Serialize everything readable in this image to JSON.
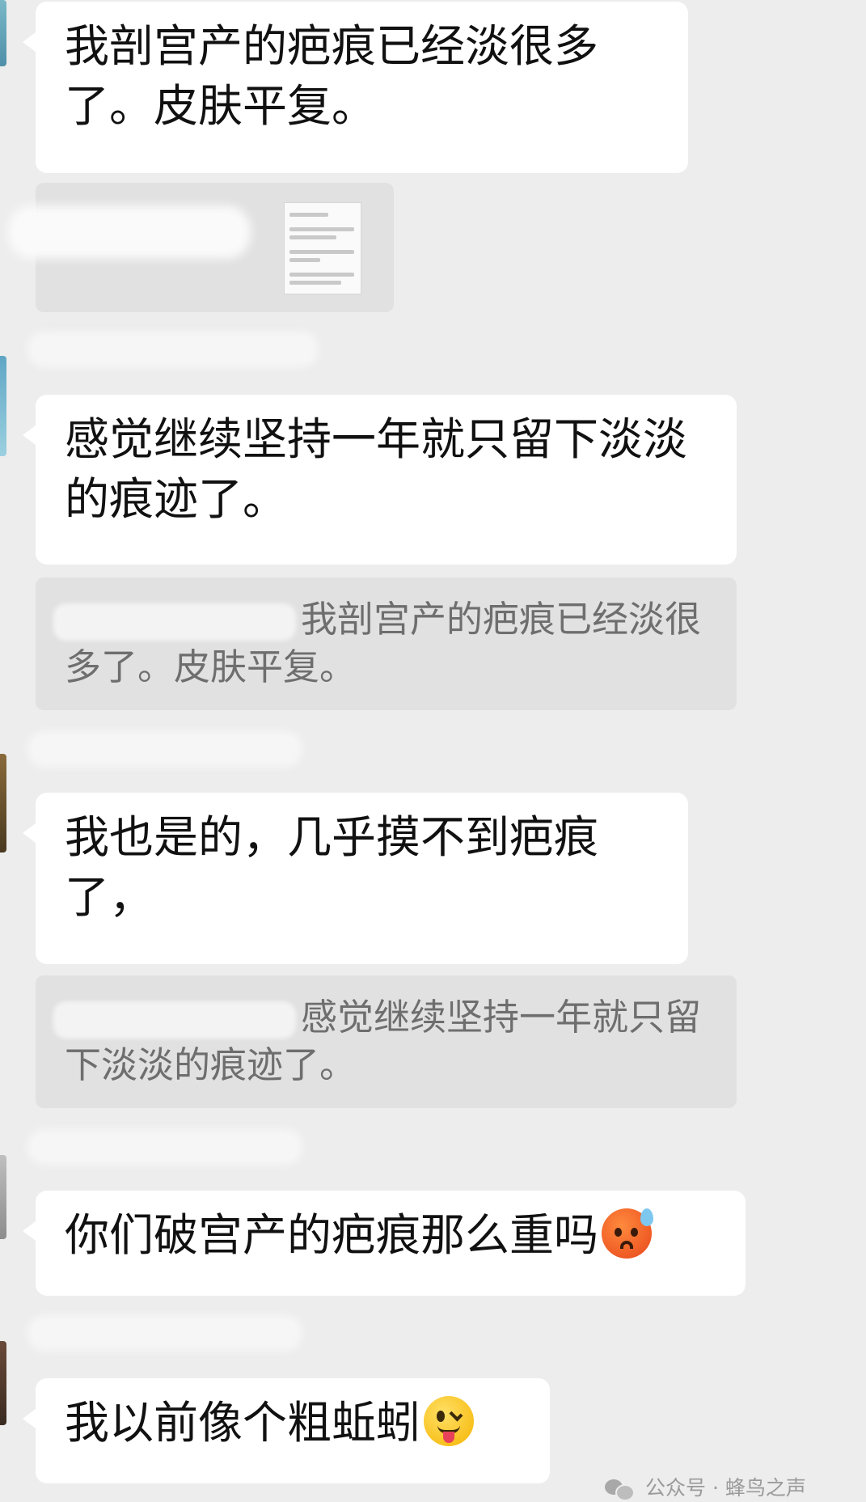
{
  "messages": [
    {
      "type": "text",
      "text": "我剖宫产的疤痕已经淡很多了。皮肤平复。"
    },
    {
      "type": "text",
      "text": "感觉继续坚持一年就只留下淡淡的痕迹了。"
    },
    {
      "type": "quote",
      "text": "我剖宫产的疤痕已经淡很多了。皮肤平复。"
    },
    {
      "type": "text",
      "text": "我也是的，几乎摸不到疤痕了，"
    },
    {
      "type": "quote",
      "text": "感觉继续坚持一年就只留下淡淡的痕迹了。"
    },
    {
      "type": "text",
      "text": "你们破宫产的疤痕那么重吗",
      "emoji": "sweat-smile-icon"
    },
    {
      "type": "text",
      "text": "我以前像个粗蚯蚓",
      "emoji": "wink-tongue-icon"
    }
  ],
  "quote_image": {
    "thumb_lines": [
      "平复了",
      "感觉继续坚持一年就只留下淡淡的痕迹了",
      "我也是的几乎摸不到疤痕了",
      "你们破宫产的疤痕那么重吗"
    ]
  },
  "watermark": {
    "icon": "wechat-icon",
    "text": "公众号 · 蜂鸟之声"
  },
  "colors": {
    "background": "#ededed",
    "bubble": "#ffffff",
    "quote": "#e1e1e1"
  }
}
